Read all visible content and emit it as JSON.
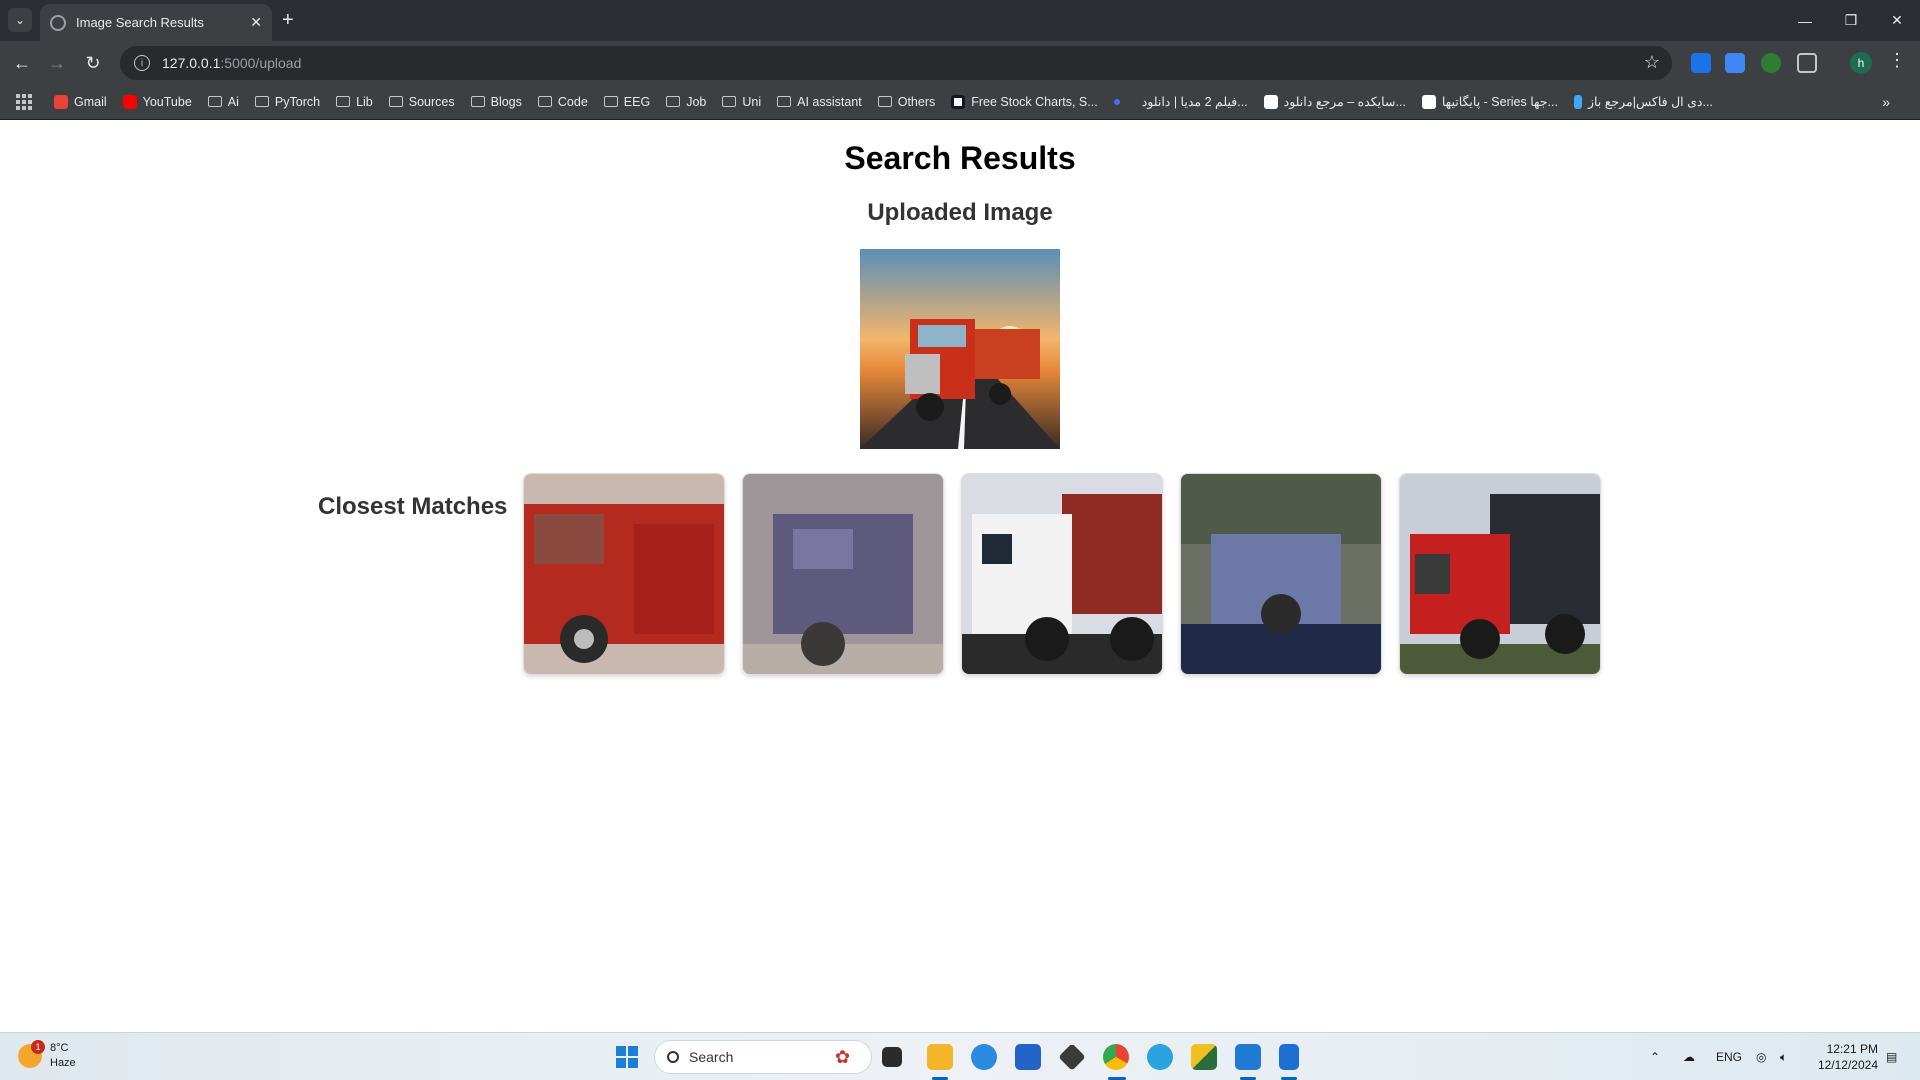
{
  "browser": {
    "tab_title": "Image Search Results",
    "url_host": "127.0.0.1",
    "url_path": ":5000/upload",
    "profile_initial": "h",
    "bookmarks": [
      {
        "label": "Gmail",
        "icon": "gmail-icon",
        "color": "#ea4335"
      },
      {
        "label": "YouTube",
        "icon": "youtube-icon",
        "color": "#ff0000"
      },
      {
        "label": "Ai",
        "icon": "folder-icon"
      },
      {
        "label": "PyTorch",
        "icon": "folder-icon"
      },
      {
        "label": "Lib",
        "icon": "folder-icon"
      },
      {
        "label": "Sources",
        "icon": "folder-icon"
      },
      {
        "label": "Blogs",
        "icon": "folder-icon"
      },
      {
        "label": "Code",
        "icon": "folder-icon"
      },
      {
        "label": "EEG",
        "icon": "folder-icon"
      },
      {
        "label": "Job",
        "icon": "folder-icon"
      },
      {
        "label": "Uni",
        "icon": "folder-icon"
      },
      {
        "label": "AI assistant",
        "icon": "folder-icon"
      },
      {
        "label": "Others",
        "icon": "folder-icon"
      },
      {
        "label": "Free Stock Charts, S...",
        "icon": "tradingview-icon",
        "color": "#ffffff"
      },
      {
        "label": "",
        "icon": "site-icon",
        "color": "#4a6cf7"
      },
      {
        "label": "فیلم 2 مدیا | دانلود...",
        "icon": "none"
      },
      {
        "label": "سایکده – مرجع دانلود...",
        "icon": "s-site-icon",
        "color": "#ffffff"
      },
      {
        "label": "پایگاتیها - Series جها...",
        "icon": "w-site-icon",
        "color": "#ffffff"
      },
      {
        "label": "دی ال فاکس|مرجع باز...",
        "icon": "d-site-icon",
        "color": "#3fa9f5"
      }
    ]
  },
  "page": {
    "title": "Search Results",
    "uploaded_heading": "Uploaded Image",
    "matches_heading": "Closest Matches"
  },
  "taskbar": {
    "weather_temp": "8°C",
    "weather_desc": "Haze",
    "weather_badge": "1",
    "search_placeholder": "Search",
    "language": "ENG",
    "time": "12:21 PM",
    "date": "12/12/2024"
  }
}
